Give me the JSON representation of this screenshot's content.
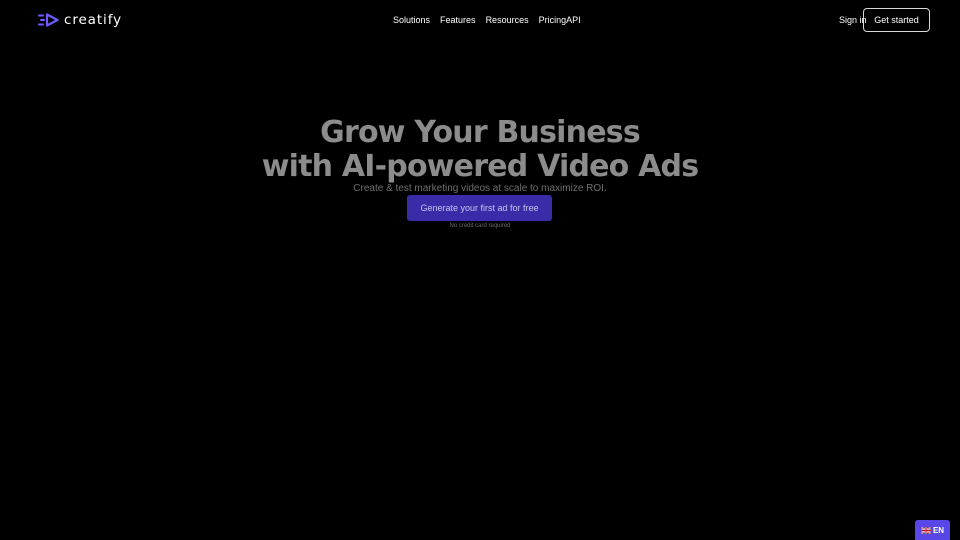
{
  "brand": {
    "name": "creatify",
    "accent": "#6c5cff"
  },
  "nav": {
    "items": [
      "Solutions",
      "Features",
      "Resources",
      "Pricing",
      "API"
    ]
  },
  "header": {
    "sign_in": "Sign in",
    "get_started": "Get started"
  },
  "hero": {
    "title_line1": "Grow Your Business",
    "title_line2": "with AI-powered Video Ads",
    "subtitle": "Create & test marketing videos at scale to maximize ROI.",
    "cta": "Generate your first ad for free",
    "note": "No credit card required"
  },
  "language": {
    "code": "EN",
    "flag_icon": "uk-flag-icon",
    "color": "#5847e6"
  }
}
